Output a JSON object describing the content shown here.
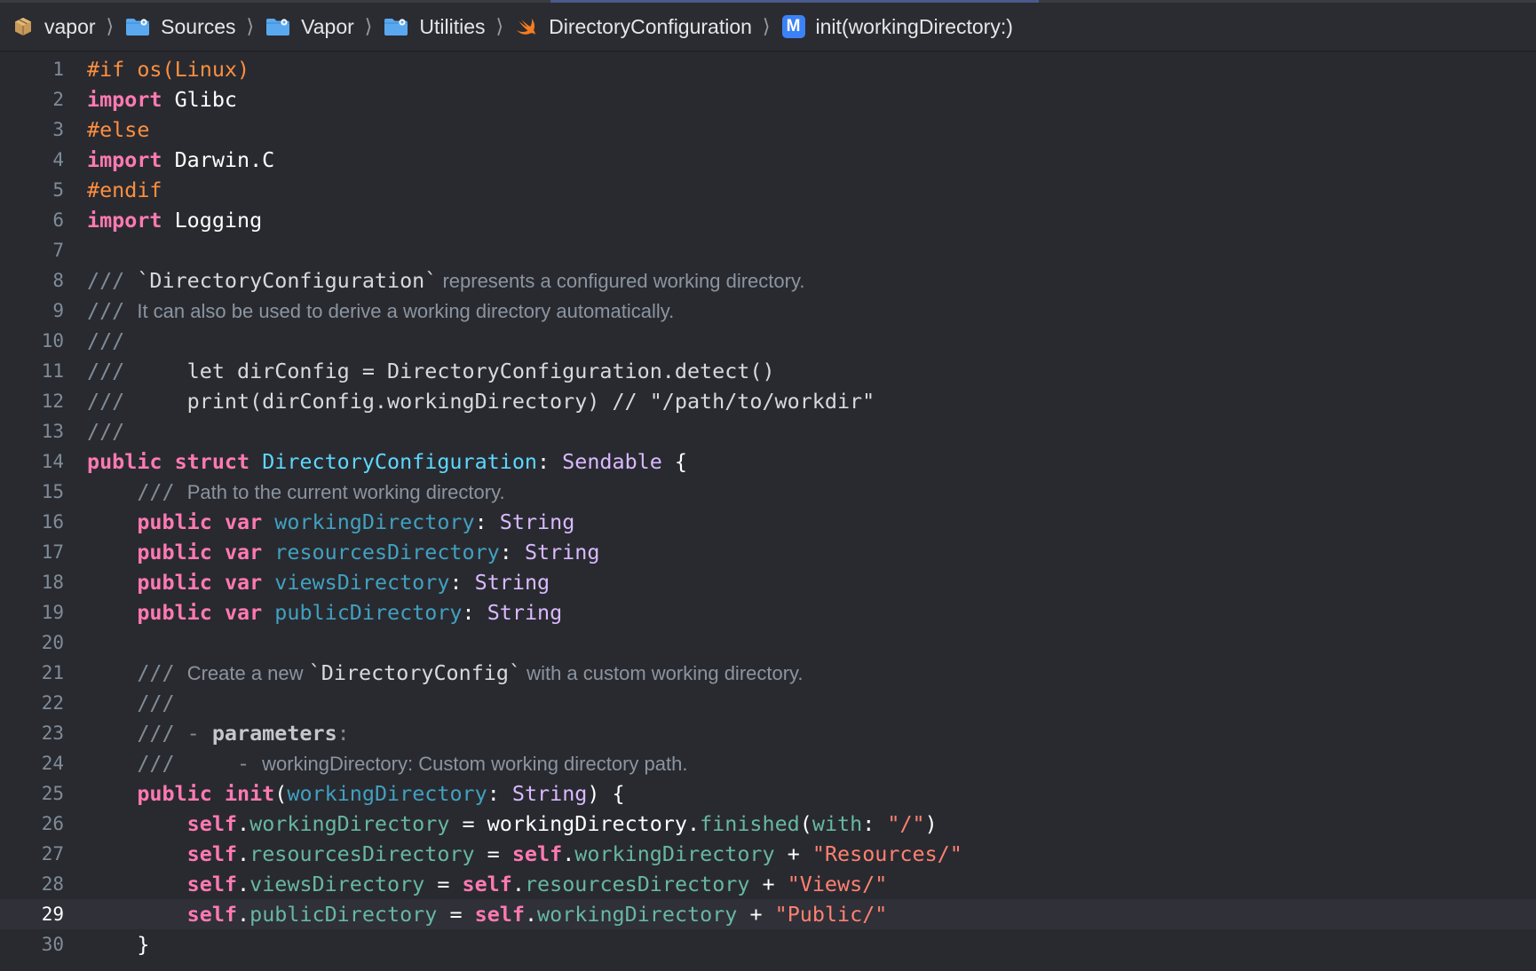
{
  "breadcrumb": [
    {
      "label": "vapor",
      "icon": "package-icon"
    },
    {
      "label": "Sources",
      "icon": "folder-icon"
    },
    {
      "label": "Vapor",
      "icon": "folder-icon"
    },
    {
      "label": "Utilities",
      "icon": "folder-icon"
    },
    {
      "label": "DirectoryConfiguration",
      "icon": "swift-file-icon"
    },
    {
      "label": "init(workingDirectory:)",
      "icon": "method-icon",
      "badge": "M"
    }
  ],
  "breadcrumb_separator": "⟩",
  "editor": {
    "current_line": 29,
    "lines": [
      {
        "n": "1",
        "tokens": [
          [
            "pp",
            "#if os(Linux)"
          ]
        ]
      },
      {
        "n": "2",
        "tokens": [
          [
            "kw",
            "import"
          ],
          [
            "plain",
            " Glibc"
          ]
        ]
      },
      {
        "n": "3",
        "tokens": [
          [
            "pp",
            "#else"
          ]
        ]
      },
      {
        "n": "4",
        "tokens": [
          [
            "kw",
            "import"
          ],
          [
            "plain",
            " Darwin.C"
          ]
        ]
      },
      {
        "n": "5",
        "tokens": [
          [
            "pp",
            "#endif"
          ]
        ]
      },
      {
        "n": "6",
        "tokens": [
          [
            "kw",
            "import"
          ],
          [
            "plain",
            " Logging"
          ]
        ]
      },
      {
        "n": "7",
        "tokens": []
      },
      {
        "n": "8",
        "tokens": [
          [
            "cm",
            "/// "
          ],
          [
            "doccode",
            "`DirectoryConfiguration`"
          ],
          [
            "doc",
            " represents a configured working directory."
          ]
        ]
      },
      {
        "n": "9",
        "tokens": [
          [
            "cm",
            "/// "
          ],
          [
            "doc",
            "It can also be used to derive a working directory automatically."
          ]
        ]
      },
      {
        "n": "10",
        "tokens": [
          [
            "cm",
            "///"
          ]
        ]
      },
      {
        "n": "11",
        "tokens": [
          [
            "cm",
            "/// "
          ],
          [
            "doccode",
            "    let dirConfig = DirectoryConfiguration.detect()"
          ]
        ]
      },
      {
        "n": "12",
        "tokens": [
          [
            "cm",
            "/// "
          ],
          [
            "doccode",
            "    print(dirConfig.workingDirectory) // \"/path/to/workdir\""
          ]
        ]
      },
      {
        "n": "13",
        "tokens": [
          [
            "cm",
            "///"
          ]
        ]
      },
      {
        "n": "14",
        "tokens": [
          [
            "kw",
            "public"
          ],
          [
            "plain",
            " "
          ],
          [
            "kw",
            "struct"
          ],
          [
            "plain",
            " "
          ],
          [
            "tdecl",
            "DirectoryConfiguration"
          ],
          [
            "plain",
            ": "
          ],
          [
            "typ",
            "Sendable"
          ],
          [
            "plain",
            " {"
          ]
        ]
      },
      {
        "n": "15",
        "tokens": [
          [
            "plain",
            "    "
          ],
          [
            "cm",
            "/// "
          ],
          [
            "doc",
            "Path to the current working directory."
          ]
        ]
      },
      {
        "n": "16",
        "tokens": [
          [
            "plain",
            "    "
          ],
          [
            "kw",
            "public"
          ],
          [
            "plain",
            " "
          ],
          [
            "kw",
            "var"
          ],
          [
            "plain",
            " "
          ],
          [
            "prop",
            "workingDirectory"
          ],
          [
            "plain",
            ": "
          ],
          [
            "typ",
            "String"
          ]
        ]
      },
      {
        "n": "17",
        "tokens": [
          [
            "plain",
            "    "
          ],
          [
            "kw",
            "public"
          ],
          [
            "plain",
            " "
          ],
          [
            "kw",
            "var"
          ],
          [
            "plain",
            " "
          ],
          [
            "prop",
            "resourcesDirectory"
          ],
          [
            "plain",
            ": "
          ],
          [
            "typ",
            "String"
          ]
        ]
      },
      {
        "n": "18",
        "tokens": [
          [
            "plain",
            "    "
          ],
          [
            "kw",
            "public"
          ],
          [
            "plain",
            " "
          ],
          [
            "kw",
            "var"
          ],
          [
            "plain",
            " "
          ],
          [
            "prop",
            "viewsDirectory"
          ],
          [
            "plain",
            ": "
          ],
          [
            "typ",
            "String"
          ]
        ]
      },
      {
        "n": "19",
        "tokens": [
          [
            "plain",
            "    "
          ],
          [
            "kw",
            "public"
          ],
          [
            "plain",
            " "
          ],
          [
            "kw",
            "var"
          ],
          [
            "plain",
            " "
          ],
          [
            "prop",
            "publicDirectory"
          ],
          [
            "plain",
            ": "
          ],
          [
            "typ",
            "String"
          ]
        ]
      },
      {
        "n": "20",
        "tokens": []
      },
      {
        "n": "21",
        "tokens": [
          [
            "plain",
            "    "
          ],
          [
            "cm",
            "/// "
          ],
          [
            "doc",
            "Create a new "
          ],
          [
            "doccode",
            "`DirectoryConfig`"
          ],
          [
            "doc",
            " with a custom working directory."
          ]
        ]
      },
      {
        "n": "22",
        "tokens": [
          [
            "plain",
            "    "
          ],
          [
            "cm",
            "///"
          ]
        ]
      },
      {
        "n": "23",
        "tokens": [
          [
            "plain",
            "    "
          ],
          [
            "cm",
            "/// - "
          ],
          [
            "docbold",
            "parameters"
          ],
          [
            "cm",
            ":"
          ]
        ]
      },
      {
        "n": "24",
        "tokens": [
          [
            "plain",
            "    "
          ],
          [
            "cm",
            "///     - "
          ],
          [
            "doc",
            "workingDirectory: Custom working directory path."
          ]
        ]
      },
      {
        "n": "25",
        "tokens": [
          [
            "plain",
            "    "
          ],
          [
            "kw",
            "public"
          ],
          [
            "plain",
            " "
          ],
          [
            "kw",
            "init"
          ],
          [
            "plain",
            "("
          ],
          [
            "prop",
            "workingDirectory"
          ],
          [
            "plain",
            ": "
          ],
          [
            "typ",
            "String"
          ],
          [
            "plain",
            ") {"
          ]
        ]
      },
      {
        "n": "26",
        "tokens": [
          [
            "plain",
            "        "
          ],
          [
            "kw",
            "self"
          ],
          [
            "plain",
            "."
          ],
          [
            "prop2",
            "workingDirectory"
          ],
          [
            "plain",
            " = workingDirectory."
          ],
          [
            "prop2",
            "finished"
          ],
          [
            "plain",
            "("
          ],
          [
            "prop2",
            "with"
          ],
          [
            "plain",
            ": "
          ],
          [
            "str",
            "\"/\""
          ],
          [
            "plain",
            ")"
          ]
        ]
      },
      {
        "n": "27",
        "tokens": [
          [
            "plain",
            "        "
          ],
          [
            "kw",
            "self"
          ],
          [
            "plain",
            "."
          ],
          [
            "prop2",
            "resourcesDirectory"
          ],
          [
            "plain",
            " = "
          ],
          [
            "kw",
            "self"
          ],
          [
            "plain",
            "."
          ],
          [
            "prop2",
            "workingDirectory"
          ],
          [
            "plain",
            " + "
          ],
          [
            "str",
            "\"Resources/\""
          ]
        ]
      },
      {
        "n": "28",
        "tokens": [
          [
            "plain",
            "        "
          ],
          [
            "kw",
            "self"
          ],
          [
            "plain",
            "."
          ],
          [
            "prop2",
            "viewsDirectory"
          ],
          [
            "plain",
            " = "
          ],
          [
            "kw",
            "self"
          ],
          [
            "plain",
            "."
          ],
          [
            "prop2",
            "resourcesDirectory"
          ],
          [
            "plain",
            " + "
          ],
          [
            "str",
            "\"Views/\""
          ]
        ]
      },
      {
        "n": "29",
        "tokens": [
          [
            "plain",
            "        "
          ],
          [
            "kw",
            "self"
          ],
          [
            "plain",
            "."
          ],
          [
            "prop2",
            "publicDirectory"
          ],
          [
            "plain",
            " = "
          ],
          [
            "kw",
            "self"
          ],
          [
            "plain",
            "."
          ],
          [
            "prop2",
            "workingDirectory"
          ],
          [
            "plain",
            " + "
          ],
          [
            "str",
            "\"Public/\""
          ]
        ]
      },
      {
        "n": "30",
        "tokens": [
          [
            "plain",
            "    }"
          ]
        ]
      }
    ]
  },
  "colors": {
    "background": "#292a30",
    "keyword": "#ff7ab2",
    "preprocessor": "#fd8f3f",
    "comment": "#7f8c98",
    "type_declaration": "#5dd8ff",
    "type": "#dabaff",
    "property_declaration": "#41a1c0",
    "property_reference": "#67b7a4",
    "string": "#ff8170",
    "method_badge": "#3b82f6"
  }
}
